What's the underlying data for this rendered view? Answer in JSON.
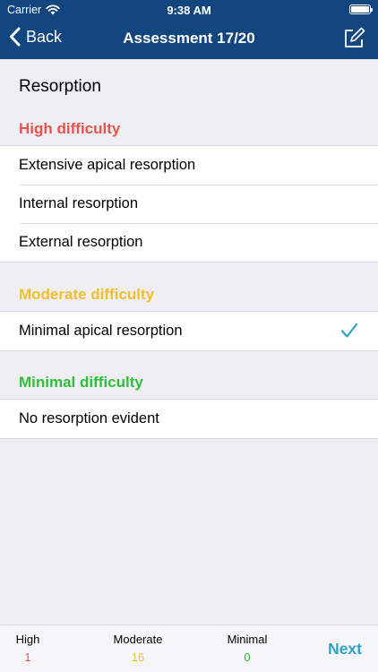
{
  "status_bar": {
    "carrier": "Carrier",
    "time": "9:38 AM"
  },
  "nav": {
    "back_label": "Back",
    "title": "Assessment 17/20"
  },
  "question": "Resorption",
  "sections": [
    {
      "title": "High difficulty",
      "color": "#e8534e",
      "items": [
        "Extensive apical resorption",
        "Internal resorption",
        "External resorption"
      ]
    },
    {
      "title": "Moderate difficulty",
      "color": "#f2bf2c",
      "items": [
        "Minimal apical resorption"
      ],
      "selected": "Minimal apical resorption"
    },
    {
      "title": "Minimal difficulty",
      "color": "#2fbf3a",
      "items": [
        "No resorption evident"
      ]
    }
  ],
  "footer": {
    "high": {
      "label": "High",
      "count": "1",
      "color": "#e8534e"
    },
    "moderate": {
      "label": "Moderate",
      "count": "16",
      "color": "#f2bf2c"
    },
    "minimal": {
      "label": "Minimal",
      "count": "0",
      "color": "#2fbf3a"
    },
    "next_label": "Next"
  },
  "colors": {
    "nav_bg": "#13457f",
    "accent": "#2aa2c4",
    "background": "#eeeef3"
  }
}
